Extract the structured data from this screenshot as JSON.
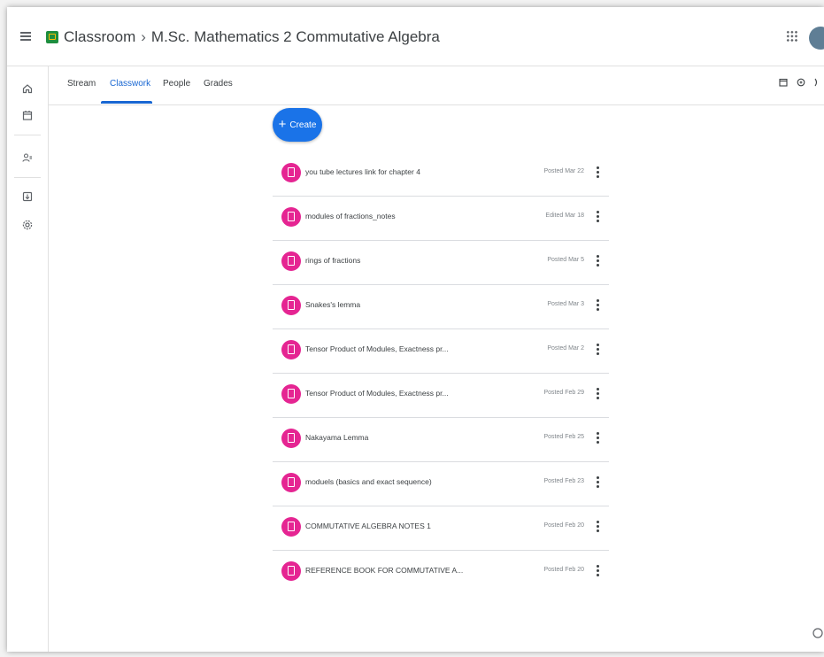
{
  "header": {
    "app_name": "Classroom",
    "separator": "›",
    "class_name": "M.Sc. Mathematics 2 Commutative Algebra"
  },
  "tabs": [
    {
      "label": "Stream"
    },
    {
      "label": "Classwork"
    },
    {
      "label": "People"
    },
    {
      "label": "Grades"
    }
  ],
  "active_tab": "Classwork",
  "create_button": {
    "icon": "+",
    "label": "Create"
  },
  "classwork_items": [
    {
      "title": "you tube lectures link for chapter 4",
      "date": "Posted Mar 22"
    },
    {
      "title": "modules of fractions_notes",
      "date": "Edited Mar 18"
    },
    {
      "title": "rings of fractions",
      "date": "Posted Mar 5"
    },
    {
      "title": "Snakes's lemma",
      "date": "Posted Mar 3"
    },
    {
      "title": "Tensor Product of Modules, Exactness pr...",
      "date": "Posted Mar 2"
    },
    {
      "title": "Tensor Product of Modules, Exactness pr...",
      "date": "Posted Feb 29"
    },
    {
      "title": "Nakayama Lemma",
      "date": "Posted Feb 25"
    },
    {
      "title": "moduels (basics and exact sequence)",
      "date": "Posted Feb 23"
    },
    {
      "title": "COMMUTATIVE ALGEBRA NOTES 1",
      "date": "Posted Feb 20"
    },
    {
      "title": "REFERENCE BOOK FOR COMMUTATIVE A...",
      "date": "Posted Feb 20"
    }
  ],
  "colors": {
    "accent": "#1a73e8",
    "active_tab": "#1967d2",
    "material_icon": "#e52592",
    "logo": "#1e8e3e"
  }
}
